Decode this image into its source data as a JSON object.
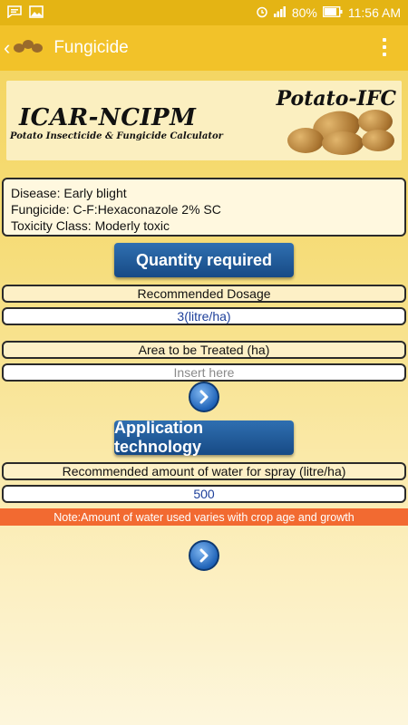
{
  "status_bar": {
    "battery": "80%",
    "time": "11:56 AM"
  },
  "app_bar": {
    "title": "Fungicide"
  },
  "banner": {
    "brand": "ICAR-NCIPM",
    "app_name": "Potato-IFC",
    "subtitle": "Potato Insecticide & Fungicide Calculator"
  },
  "info": {
    "disease": "Disease: Early blight",
    "fungicide": "Fungicide:  C-F:Hexaconazole 2% SC",
    "toxicity": "Toxicity Class: Moderly toxic"
  },
  "quantity": {
    "button_label": "Quantity required",
    "dosage_label": "Recommended Dosage",
    "dosage_value": "3(litre/ha)",
    "area_label": "Area to be Treated (ha)",
    "area_placeholder": "Insert here"
  },
  "application": {
    "button_label": "Application technology",
    "water_label": "Recommended amount of water for spray (litre/ha)",
    "water_value": "500",
    "note": "Note:Amount of water used varies with crop age and growth"
  },
  "colors": {
    "status_bar": "#e4b414",
    "app_bar": "#f2c229",
    "button": "#1f5a9c",
    "note": "#f26a31"
  }
}
